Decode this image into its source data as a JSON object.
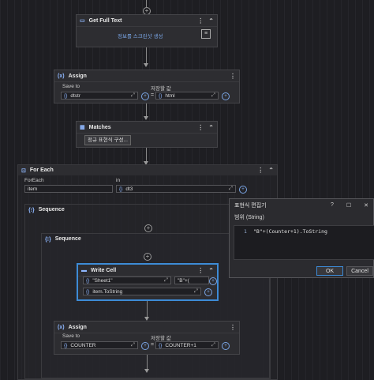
{
  "get_full_text": {
    "title": "Get Full Text",
    "field_text": "정보를 스크린샷 생성"
  },
  "assign1": {
    "title": "Assign",
    "save_to_label": "Save to",
    "value_label": "저장할 값",
    "save_to_value": "dtstr",
    "value_value": "html",
    "equals": "="
  },
  "matches": {
    "title": "Matches",
    "button_label": "정규 표현식 구성..."
  },
  "foreach": {
    "title": "For Each",
    "foreach_label": "ForEach",
    "in_label": "in",
    "item_value": "item",
    "in_value": "dt3"
  },
  "sequence_outer": {
    "title": "Sequence"
  },
  "sequence_inner": {
    "title": "Sequence"
  },
  "write_cell": {
    "title": "Write Cell",
    "sheet_value": "\"Sheet1\"",
    "cell_value": "\"B\"+(",
    "text_value": "item.ToString"
  },
  "assign2": {
    "title": "Assign",
    "save_to_label": "Save to",
    "value_label": "저장할 값",
    "save_to_value": "COUNTER",
    "value_value": "COUNTER+1",
    "equals": "="
  },
  "dialog": {
    "title": "표현식 편집기",
    "help": "?",
    "maximize": "☐",
    "close": "✕",
    "subtitle": "범위 (String)",
    "line_number": "1",
    "code": "\"B\"+(Counter+1).ToString",
    "ok_label": "OK",
    "cancel_label": "Cancel"
  },
  "colors": {
    "accent": "#3d8bd6",
    "background": "#1e1e22",
    "card": "#2d2d31"
  }
}
